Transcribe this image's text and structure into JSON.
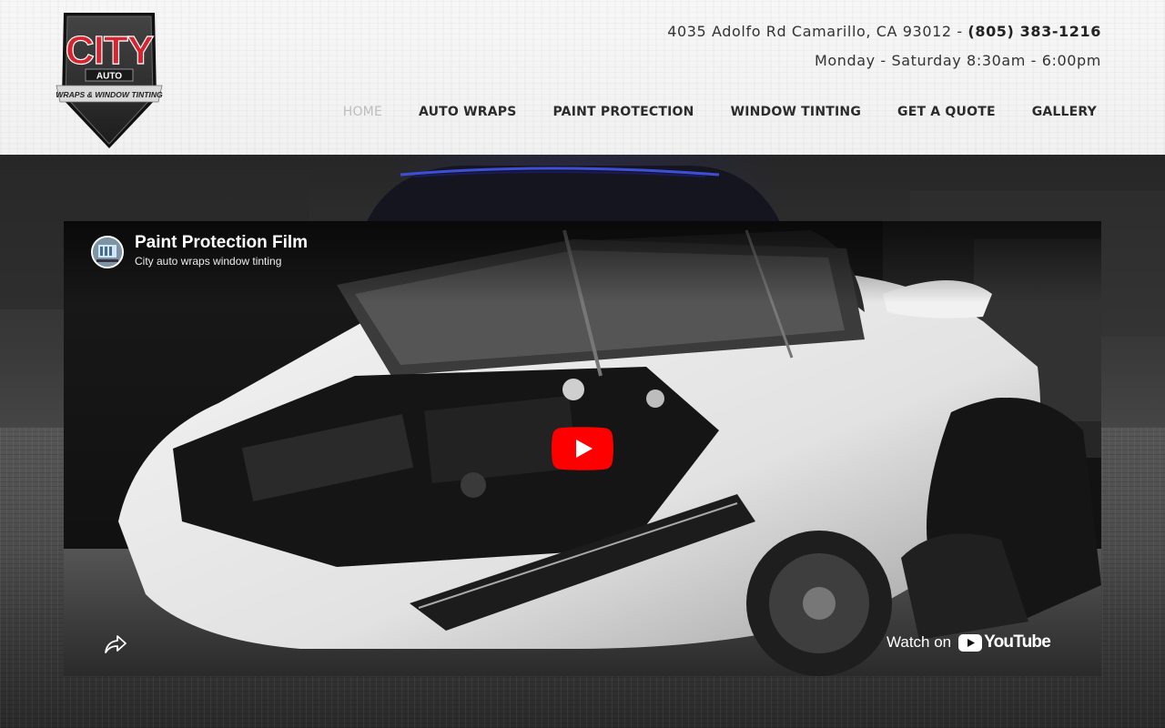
{
  "brand": {
    "logo_word": "CITY",
    "logo_sub": "AUTO",
    "logo_banner": "WRAPS & WINDOW TINTING",
    "accent_red": "#d8242f",
    "shield_dark": "#2a2a2a"
  },
  "contact": {
    "address": "4035 Adolfo Rd Camarillo, CA 93012 - ",
    "phone": "(805) 383-1216",
    "hours": "Monday - Saturday 8:30am - 6:00pm"
  },
  "nav": {
    "items": [
      {
        "label": "HOME",
        "active": true
      },
      {
        "label": "AUTO WRAPS",
        "active": false
      },
      {
        "label": "PAINT PROTECTION",
        "active": false
      },
      {
        "label": "WINDOW TINTING",
        "active": false
      },
      {
        "label": "GET A QUOTE",
        "active": false
      },
      {
        "label": "GALLERY",
        "active": false
      }
    ]
  },
  "video": {
    "title": "Paint Protection Film",
    "channel": "City auto wraps window tinting",
    "watch_on_label": "Watch on",
    "platform_name": "YouTube",
    "play_color": "#ff0000",
    "icons": {
      "play": "play-icon",
      "share": "share-icon",
      "platform": "youtube-logo-icon"
    }
  }
}
